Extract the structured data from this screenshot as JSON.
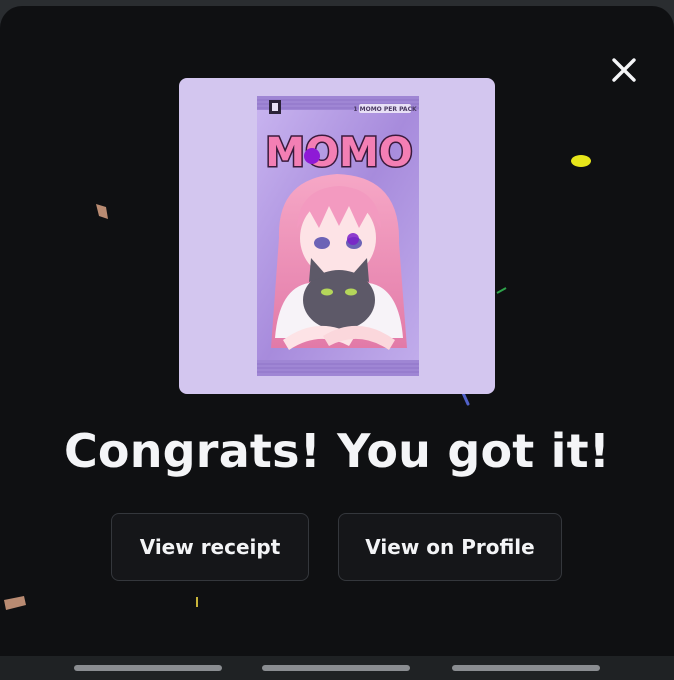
{
  "modal": {
    "close_icon": "close-icon",
    "pack_image": {
      "brand": "MOMO",
      "badge": "1 MOMO PER PACK",
      "colors": {
        "bg": "#d3c6ef",
        "pack": "#b39ae4",
        "title_fill": "#f37fb4",
        "title_outline": "#3a1a3c"
      }
    },
    "headline": "Congrats! You got it!",
    "buttons": {
      "receipt": "View receipt",
      "profile": "View on Profile"
    }
  },
  "colors": {
    "background": "#0f1012",
    "button_bg": "#151619",
    "button_border": "#34373c",
    "text": "#f4f5f7"
  }
}
